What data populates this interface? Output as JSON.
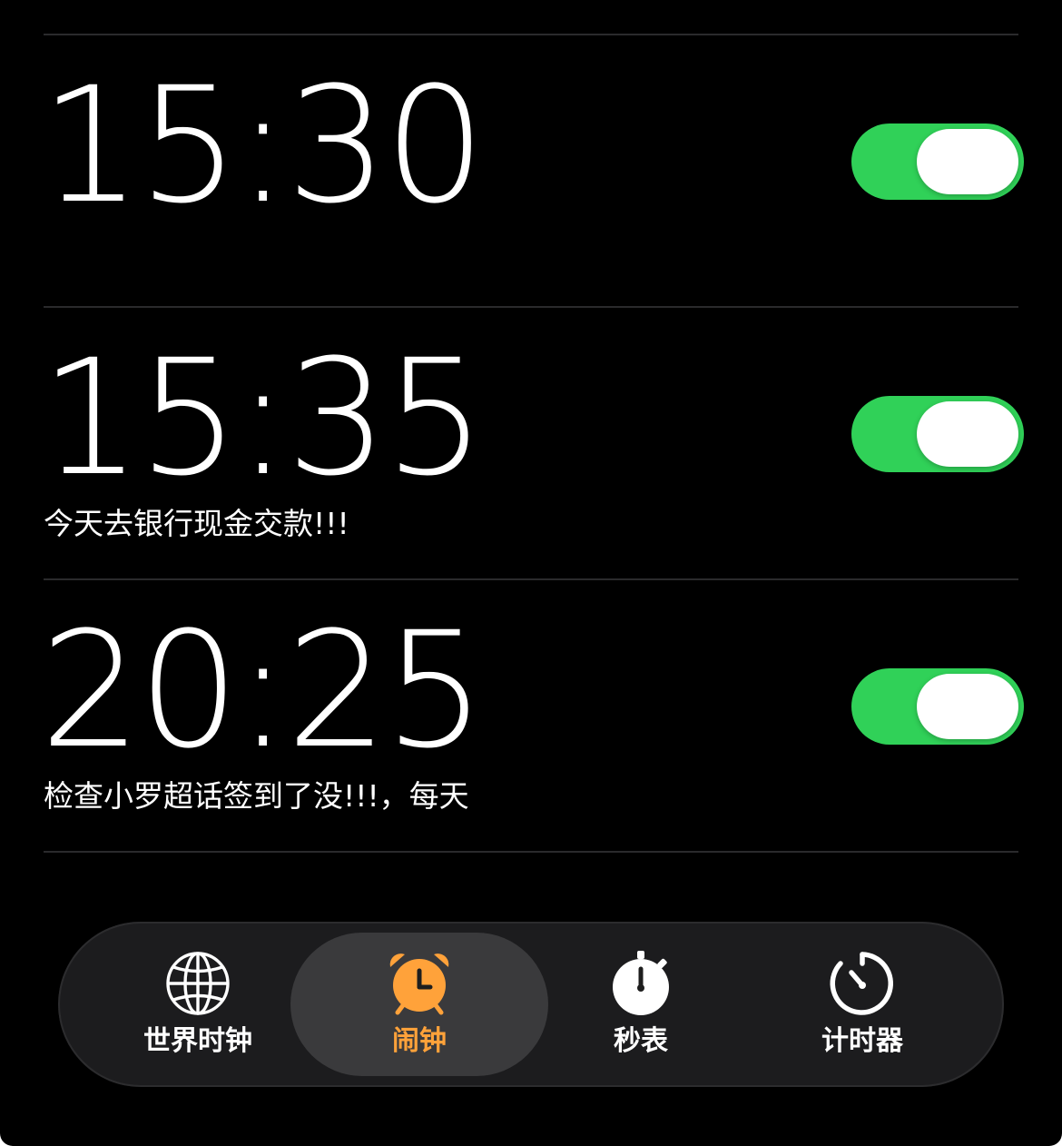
{
  "alarms": [
    {
      "time": "15:30",
      "label": "",
      "enabled": true
    },
    {
      "time": "15:35",
      "label": "今天去银行现金交款!!!",
      "enabled": true
    },
    {
      "time": "20:25",
      "label": "检查小罗超话签到了没!!!，每天",
      "enabled": true
    }
  ],
  "tabbar": {
    "tabs": [
      {
        "label": "世界时钟",
        "icon": "globe-icon",
        "active": false
      },
      {
        "label": "闹钟",
        "icon": "alarm-clock-icon",
        "active": true
      },
      {
        "label": "秒表",
        "icon": "stopwatch-icon",
        "active": false
      },
      {
        "label": "计时器",
        "icon": "timer-icon",
        "active": false
      }
    ]
  },
  "colors": {
    "background": "#000000",
    "toggle_on": "#30d158",
    "accent": "#ffa23a",
    "tabbar_bg": "#1c1c1e",
    "active_tab_bg": "#3a3a3c",
    "divider": "#2a2a2c"
  }
}
